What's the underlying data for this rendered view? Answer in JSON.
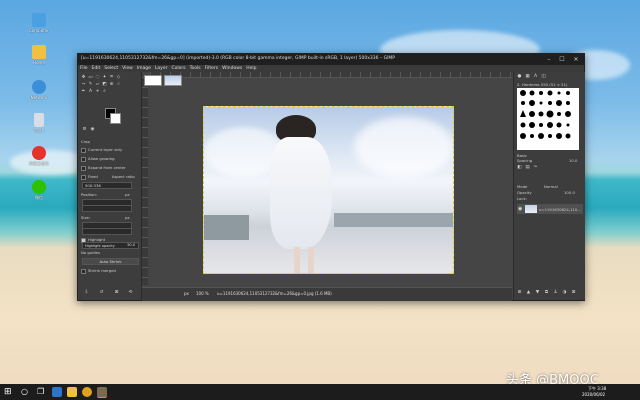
{
  "desktop": {
    "icons": [
      {
        "label": "Computer",
        "color": "#4aa0e0",
        "icon": "computer-icon"
      },
      {
        "label": "Home",
        "color": "#f0c040",
        "icon": "folder-icon"
      },
      {
        "label": "Network",
        "color": "#3b8ed8",
        "icon": "network-icon"
      },
      {
        "label": "Trash",
        "color": "#d8dde6",
        "icon": "trash-icon"
      },
      {
        "label": "网易云音乐",
        "color": "#e5322d",
        "icon": "netease-music-icon"
      },
      {
        "label": "微信",
        "color": "#2dc100",
        "icon": "wechat-icon"
      }
    ]
  },
  "window": {
    "title": "[u=1191630624,1105312732&fm=26&gp=0] (imported)-3.0 (RGB color 8-bit gamma integer, GIMP built-in sRGB, 1 layer) 500x336 – GIMP",
    "minimize": "–",
    "maximize": "☐",
    "close": "✕"
  },
  "menu": [
    "File",
    "Edit",
    "Select",
    "View",
    "Image",
    "Layer",
    "Colors",
    "Tools",
    "Filters",
    "Windows",
    "Help"
  ],
  "toolbox": {
    "options": [
      {
        "label": "Current layer only",
        "checked": false
      },
      {
        "label": "Allow growing",
        "checked": false
      },
      {
        "label": "Expand from center",
        "checked": false
      },
      {
        "label": "Fixed",
        "checked": false,
        "value": "Aspect ratio"
      }
    ],
    "size_value": "500:336",
    "position_label": "Position:",
    "position_unit": "px",
    "size_label": "Size:",
    "size_unit": "px",
    "highlight_label": "Highlight",
    "highlight_opacity": "Highlight opacity",
    "highlight_opacity_value": "50.0",
    "guides_label": "No guides",
    "autoshrink_label": "Auto Shrink",
    "shrink_merged_label": "Shrink merged"
  },
  "status": {
    "unit": "px",
    "zoom": "100 %",
    "file": "u=1191630624,1105312732&fm=26&gp=0.jpg (1.6 MB)"
  },
  "dock": {
    "brushes_title": "2. Hardness 050 (51 × 51)",
    "brushes_tag": "Basic",
    "spacing_label": "Spacing",
    "spacing_value": "10.0",
    "mode_label": "Mode",
    "mode_value": "Normal",
    "opacity_label": "Opacity",
    "opacity_value": "100.0",
    "lock_label": "Lock:",
    "layer_name": "u=1191630624,110..."
  },
  "taskbar": {
    "time": "下午 3:38",
    "date": "2020/06/02"
  },
  "watermark": "头条 @BMOOC"
}
